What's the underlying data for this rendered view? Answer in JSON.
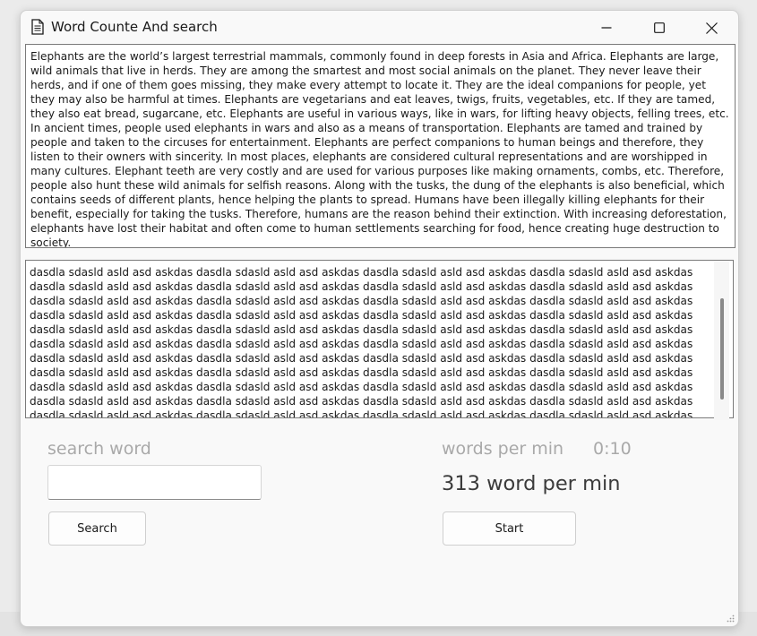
{
  "window": {
    "title": "Word Counte And search",
    "icon": "document-icon",
    "controls": [
      "minimize-icon",
      "maximize-icon",
      "close-icon"
    ]
  },
  "article": {
    "text": "Elephants are the world’s largest terrestrial mammals, commonly found in deep forests in Asia and Africa. Elephants are large, wild animals that live in herds. They are among the smartest and most social animals on the planet. They never leave their herds, and if one of them goes missing, they make every attempt to locate it. They are the ideal companions for people, yet they may also be harmful at times. Elephants are vegetarians and eat leaves, twigs, fruits, vegetables, etc. If they are tamed, they also eat bread, sugarcane, etc. Elephants are useful in various ways, like in wars, for lifting heavy objects, felling trees, etc. In ancient times, people used elephants in wars and also as a means of transportation. Elephants are tamed and trained by people and taken to the circuses for entertainment. Elephants are perfect companions to human beings and therefore, they listen to their owners with sincerity. In most places, elephants are considered cultural representations and are worshipped in many cultures. Elephant teeth are very costly and are used for various purposes like making ornaments, combs, etc. Therefore, people also hunt these wild animals for selfish reasons. Along with the tusks, the dung of the elephants is also beneficial, which contains seeds of different plants, hence helping the plants to spread. Humans have been illegally killing elephants for their benefit, especially for taking the tusks. Therefore, humans are the reason behind their extinction. With increasing deforestation, elephants have lost their habitat and often come to human settlements searching for food, hence creating huge destruction to society."
  },
  "typing": {
    "text": "dasdla sdasld asld asd askdas dasdla sdasld asld asd askdas dasdla sdasld asld asd askdas dasdla sdasld asld asd askdas dasdla sdasld asld asd askdas dasdla sdasld asld asd askdas dasdla sdasld asld asd askdas dasdla sdasld asld asd askdas dasdla sdasld asld asd askdas dasdla sdasld asld asd askdas dasdla sdasld asld asd askdas dasdla sdasld asld asd askdas dasdla sdasld asld asd askdas dasdla sdasld asld asd askdas dasdla sdasld asld asd askdas dasdla sdasld asld asd askdas dasdla sdasld asld asd askdas dasdla sdasld asld asd askdas dasdla sdasld asld asd askdas dasdla sdasld asld asd askdas dasdla sdasld asld asd askdas dasdla sdasld asld asd askdas dasdla sdasld asld asd askdas dasdla sdasld asld asd askdas dasdla sdasld asld asd askdas dasdla sdasld asld asd askdas dasdla sdasld asld asd askdas dasdla sdasld asld asd askdas dasdla sdasld asld asd askdas dasdla sdasld asld asd askdas dasdla sdasld asld asd askdas dasdla sdasld asld asd askdas dasdla sdasld asld asd askdas dasdla sdasld asld asd askdas dasdla sdasld asld asd askdas dasdla sdasld asld asd askdas dasdla sdasld asld asd askdas dasdla sdasld asld asd askdas dasdla sdasld asld asd askdas dasdla sdasld asld asd askdas dasdla sdasld asld asd askdas dasdla sdasld asld asd askdas dasdla sdasld asld asd askdas dasdla sdasld asld asd askdas dasdla sdasld asld asd askdas dasdla sdasld asld asd askdas dasdla sdasld asld asd askdas dasdla sdasld asld asd askdas dasdla sdasld asld asd askdas dasdla sdasld asld asd askdas dasdla sdasld asld asd askdas dasdla sdasld asld asd askdas dasdla sdasld asld asd askdas dasdla sdasld asld asd askdas dasdla sdasld asld asd askdas dasdla sdasld asld"
  },
  "search": {
    "label": "search word",
    "value": "",
    "placeholder": "",
    "button_label": "Search"
  },
  "stats": {
    "label": "words per min",
    "timer": "0:10",
    "result": "313 word per min",
    "start_label": "Start"
  },
  "colors": {
    "window_bg": "#f9f9f9",
    "label_gray": "#a9a9a9",
    "text_dark": "#1a1a1a"
  }
}
